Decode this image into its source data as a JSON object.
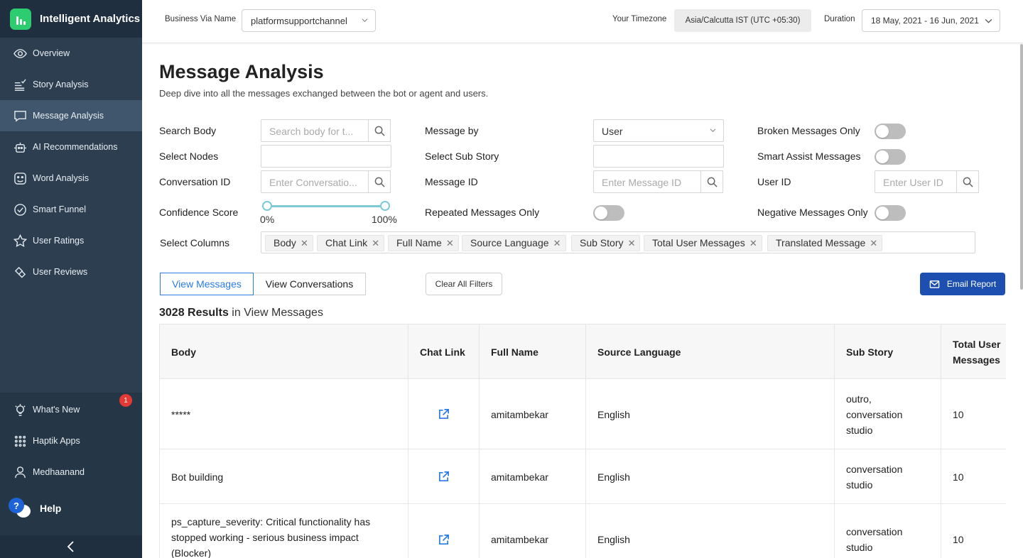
{
  "app": {
    "title": "Intelligent Analytics"
  },
  "sidebar": {
    "items": [
      {
        "label": "Overview",
        "icon": "eye-icon"
      },
      {
        "label": "Story Analysis",
        "icon": "story-list-icon"
      },
      {
        "label": "Message Analysis",
        "icon": "message-bubble-icon",
        "active": true
      },
      {
        "label": "AI Recommendations",
        "icon": "robot-icon"
      },
      {
        "label": "Word Analysis",
        "icon": "face-icon"
      },
      {
        "label": "Smart Funnel",
        "icon": "funnel-icon"
      },
      {
        "label": "User Ratings",
        "icon": "star-icon"
      },
      {
        "label": "User Reviews",
        "icon": "reviews-icon"
      }
    ],
    "bottom": [
      {
        "label": "What's New",
        "icon": "bulb-icon",
        "badge": "1"
      },
      {
        "label": "Haptik Apps",
        "icon": "grid-icon"
      },
      {
        "label": "Medhaanand",
        "icon": "user-icon"
      }
    ],
    "help": "Help",
    "help_badge": "?"
  },
  "topbar": {
    "business_label": "Business Via Name",
    "business_value": "platformsupportchannel",
    "timezone_label": "Your Timezone",
    "timezone_value": "Asia/Calcutta IST (UTC +05:30)",
    "duration_label": "Duration",
    "duration_value": "18 May, 2021 - 16 Jun, 2021"
  },
  "page": {
    "title": "Message Analysis",
    "subtitle": "Deep dive into all the messages exchanged between the bot or agent and users."
  },
  "filters": {
    "search_body_label": "Search Body",
    "search_body_placeholder": "Search body for t...",
    "message_by_label": "Message by",
    "message_by_value": "User",
    "broken_label": "Broken Messages Only",
    "select_nodes_label": "Select Nodes",
    "select_sub_story_label": "Select Sub Story",
    "smart_assist_label": "Smart Assist Messages",
    "conversation_id_label": "Conversation ID",
    "conversation_id_placeholder": "Enter Conversatio...",
    "message_id_label": "Message ID",
    "message_id_placeholder": "Enter Message ID",
    "user_id_label": "User ID",
    "user_id_placeholder": "Enter User ID",
    "confidence_label": "Confidence Score",
    "confidence_min": "0%",
    "confidence_max": "100%",
    "repeated_label": "Repeated Messages Only",
    "negative_label": "Negative Messages Only",
    "select_columns_label": "Select Columns",
    "columns": [
      "Body",
      "Chat Link",
      "Full Name",
      "Source Language",
      "Sub Story",
      "Total User Messages",
      "Translated Message"
    ]
  },
  "actions": {
    "view_messages": "View Messages",
    "view_conversations": "View Conversations",
    "clear_filters": "Clear All Filters",
    "email_report": "Email Report"
  },
  "results": {
    "count": "3028 Results",
    "suffix": " in View Messages"
  },
  "table": {
    "headers": [
      "Body",
      "Chat Link",
      "Full Name",
      "Source Language",
      "Sub Story",
      "Total User Messages"
    ],
    "rows": [
      {
        "body": "*****",
        "full_name": "amitambekar",
        "language": "English",
        "sub_story": "outro, conversation studio",
        "total": "10"
      },
      {
        "body": "Bot building",
        "full_name": "amitambekar",
        "language": "English",
        "sub_story": "conversation studio",
        "total": "10"
      },
      {
        "body": "ps_capture_severity: Critical functionality has stopped working - serious business impact (Blocker)",
        "full_name": "amitambekar",
        "language": "English",
        "sub_story": "conversation studio",
        "total": "10"
      }
    ]
  },
  "colors": {
    "sidebar": "#2c3e50",
    "active": "#40566c",
    "primary": "#2a7be4",
    "email": "#1c4fb0",
    "brand": "#2ecc71"
  }
}
